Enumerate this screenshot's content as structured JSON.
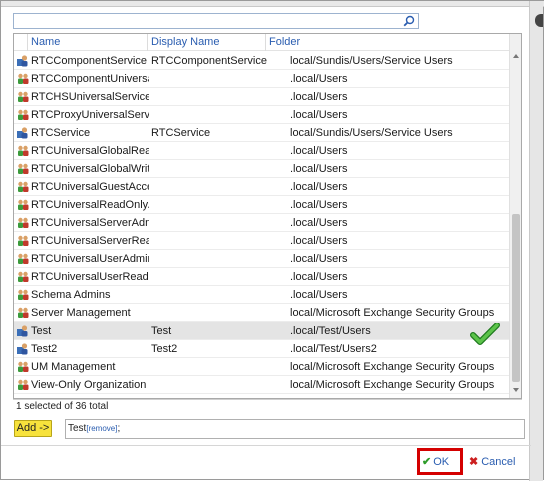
{
  "search": {
    "placeholder": ""
  },
  "columns": {
    "name": "Name",
    "display_name": "Display Name",
    "folder": "Folder"
  },
  "rows": [
    {
      "name": "RTCComponentService",
      "display_name": "RTCComponentService",
      "folder": "local/Sundis/Users/Service Users",
      "type": "user"
    },
    {
      "name": "RTCComponentUniversalSer...",
      "display_name": "",
      "folder": ".local/Users",
      "type": "group"
    },
    {
      "name": "RTCHSUniversalServices",
      "display_name": "",
      "folder": ".local/Users",
      "type": "group"
    },
    {
      "name": "RTCProxyUniversalServices",
      "display_name": "",
      "folder": ".local/Users",
      "type": "group"
    },
    {
      "name": "RTCService",
      "display_name": "RTCService",
      "folder": "local/Sundis/Users/Service Users",
      "type": "user"
    },
    {
      "name": "RTCUniversalGlobalReadOnl...",
      "display_name": "",
      "folder": ".local/Users",
      "type": "group"
    },
    {
      "name": "RTCUniversalGlobalWriteGro...",
      "display_name": "",
      "folder": ".local/Users",
      "type": "group"
    },
    {
      "name": "RTCUniversalGuestAccessGr...",
      "display_name": "",
      "folder": ".local/Users",
      "type": "group"
    },
    {
      "name": "RTCUniversalReadOnlyAdmins",
      "display_name": "",
      "folder": ".local/Users",
      "type": "group"
    },
    {
      "name": "RTCUniversalServerAdmins",
      "display_name": "",
      "folder": ".local/Users",
      "type": "group"
    },
    {
      "name": "RTCUniversalServerReadOnly...",
      "display_name": "",
      "folder": ".local/Users",
      "type": "group"
    },
    {
      "name": "RTCUniversalUserAdmins",
      "display_name": "",
      "folder": ".local/Users",
      "type": "group"
    },
    {
      "name": "RTCUniversalUserReadOnlyG...",
      "display_name": "",
      "folder": ".local/Users",
      "type": "group"
    },
    {
      "name": "Schema Admins",
      "display_name": "",
      "folder": ".local/Users",
      "type": "group"
    },
    {
      "name": "Server Management",
      "display_name": "",
      "folder": "local/Microsoft Exchange Security Groups",
      "type": "group"
    },
    {
      "name": "Test",
      "display_name": "Test",
      "folder": ".local/Test/Users",
      "type": "user",
      "selected": true
    },
    {
      "name": "Test2",
      "display_name": "Test2",
      "folder": ".local/Test/Users2",
      "type": "user"
    },
    {
      "name": "UM Management",
      "display_name": "",
      "folder": "local/Microsoft Exchange Security Groups",
      "type": "group"
    },
    {
      "name": "View-Only Organization Man...",
      "display_name": "",
      "folder": "local/Microsoft Exchange Security Groups",
      "type": "group"
    }
  ],
  "status": {
    "text": "1 selected of 36 total"
  },
  "add_button": {
    "label": "Add ->"
  },
  "selected_field": {
    "value": "Test",
    "remove_label": "[remove]",
    "separator": ";"
  },
  "buttons": {
    "ok_label": "OK",
    "cancel_label": "Cancel",
    "ok_glyph": "✔",
    "cancel_glyph": "✖"
  },
  "colors": {
    "header_text": "#2a5db0",
    "add_button": "#f7e23c",
    "ok_highlight": "#d40000",
    "selected_row": "#e4e4e4"
  }
}
